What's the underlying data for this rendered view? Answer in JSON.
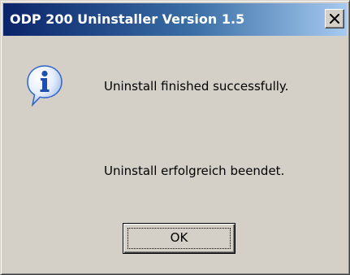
{
  "window": {
    "title": "ODP 200 Uninstaller  Version 1.5",
    "close_symbol": "×",
    "icon": "info-icon"
  },
  "message": {
    "line_en": "Uninstall finished successfully.",
    "line_de": "Uninstall erfolgreich beendet."
  },
  "buttons": {
    "ok_label": "OK"
  },
  "colors": {
    "title_gradient_start": "#0a246a",
    "title_gradient_end": "#a6caf0",
    "dialog_face": "#d4d0c8",
    "info_icon_blue": "#2f64c8"
  }
}
